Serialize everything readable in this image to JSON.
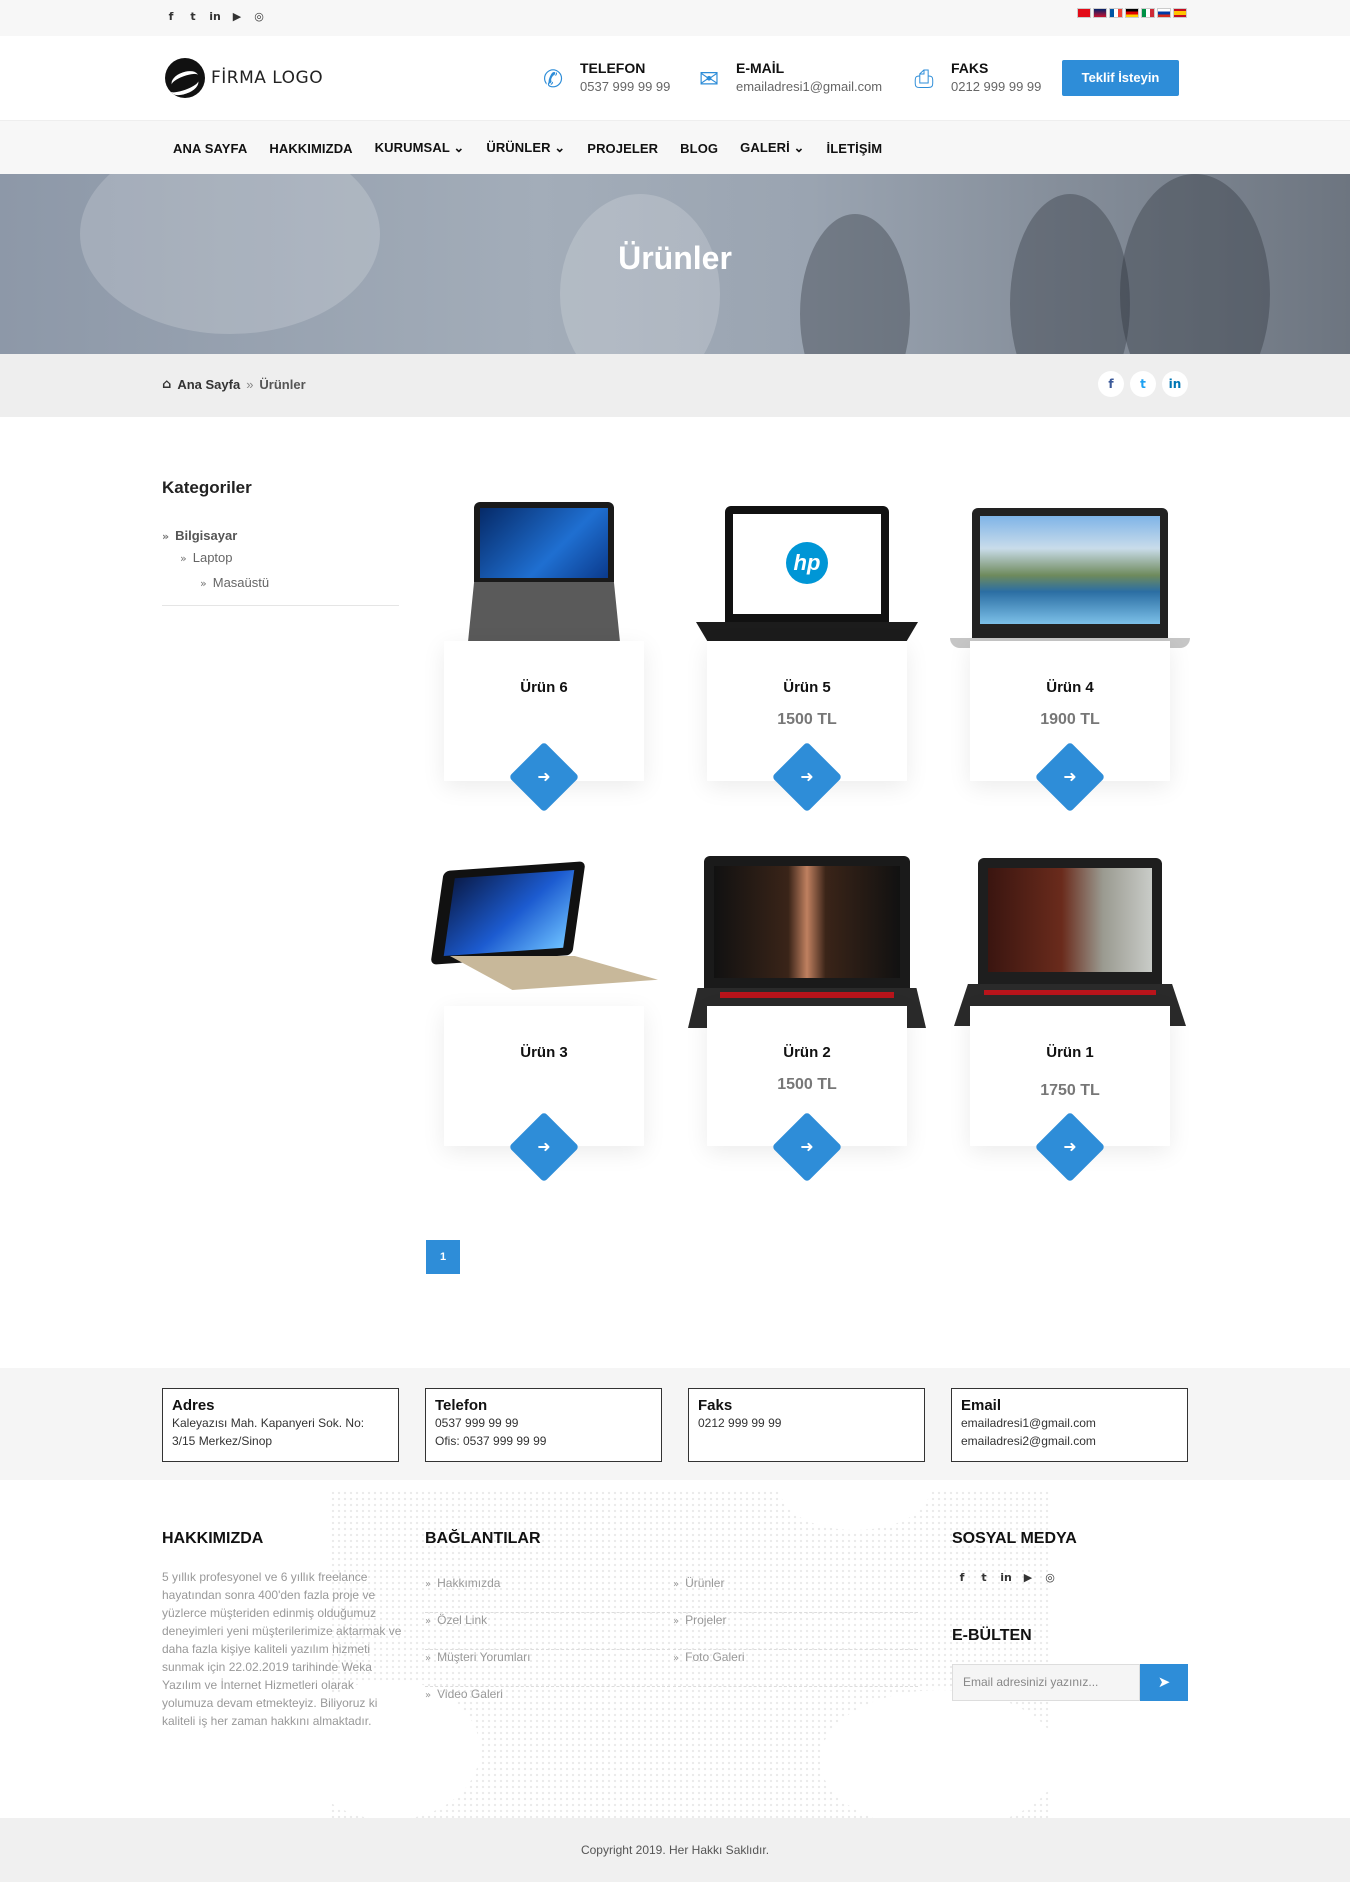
{
  "topbar": {
    "social": [
      "f",
      "t",
      "in",
      "yt",
      "ig"
    ],
    "flags": [
      {
        "name": "tr",
        "color": "#e30a17"
      },
      {
        "name": "gb",
        "color": "#012169"
      },
      {
        "name": "fr",
        "color": "#0055a4"
      },
      {
        "name": "de",
        "color": "#000000"
      },
      {
        "name": "it",
        "color": "#009246"
      },
      {
        "name": "ru",
        "color": "#0039a6"
      },
      {
        "name": "es",
        "color": "#c60b1e"
      }
    ]
  },
  "header": {
    "logo_text": "FİRMA LOGO",
    "phone": {
      "title": "TELEFON",
      "value": "0537 999 99 99"
    },
    "email": {
      "title": "E-MAİL",
      "value": "emailadresi1@gmail.com"
    },
    "fax": {
      "title": "FAKS",
      "value": "0212 999 99 99"
    },
    "cta": "Teklif İsteyin"
  },
  "nav": [
    "ANA SAYFA",
    "HAKKIMIZDA",
    "KURUMSAL ⌄",
    "ÜRÜNLER ⌄",
    "PROJELER",
    "BLOG",
    "GALERİ ⌄",
    "İLETİŞİM"
  ],
  "banner": {
    "title": "Ürünler"
  },
  "breadcrumb": {
    "home": "Ana Sayfa",
    "sep": "»",
    "current": "Ürünler"
  },
  "share": [
    "f",
    "t",
    "in"
  ],
  "sidebar": {
    "title": "Kategoriler",
    "items": [
      "Bilgisayar",
      "Laptop",
      "Masaüstü"
    ]
  },
  "products": [
    {
      "name": "Ürün 6",
      "price": ""
    },
    {
      "name": "Ürün 5",
      "price": "1500 TL"
    },
    {
      "name": "Ürün 4",
      "price": "1900 TL"
    },
    {
      "name": "Ürün 3",
      "price": ""
    },
    {
      "name": "Ürün 2",
      "price": "1500 TL"
    },
    {
      "name": "Ürün 1",
      "price": "1750 TL"
    }
  ],
  "pagination": {
    "current": "1"
  },
  "info": {
    "address": {
      "title": "Adres",
      "lines": [
        "Kaleyazısı Mah. Kapanyeri Sok. No:",
        "3/15 Merkez/Sinop"
      ]
    },
    "phone": {
      "title": "Telefon",
      "lines": [
        "0537 999 99 99",
        "Ofis: 0537 999 99 99"
      ]
    },
    "fax": {
      "title": "Faks",
      "lines": [
        "0212 999 99 99"
      ]
    },
    "email": {
      "title": "Email",
      "lines": [
        "emailadresi1@gmail.com",
        "emailadresi2@gmail.com"
      ]
    }
  },
  "footer": {
    "about_title": "HAKKIMIZDA",
    "about_text": "5 yıllık profesyonel ve 6 yıllık freelance hayatından sonra 400'den fazla proje ve yüzlerce müşteriden edinmiş olduğumuz deneyimleri yeni müşterilerimize aktarmak ve daha fazla kişiye kaliteli yazılım hizmeti sunmak için 22.02.2019 tarihinde Weka Yazılım ve İnternet Hizmetleri olarak yolumuza devam etmekteyiz. Biliyoruz ki kaliteli iş her zaman hakkını almaktadır.",
    "links_title": "BAĞLANTILAR",
    "links_left": [
      "Hakkımızda",
      "Özel Link",
      "Müşteri Yorumları",
      "Video Galeri"
    ],
    "links_right": [
      "Ürünler",
      "Projeler",
      "Foto Galeri"
    ],
    "social_title": "SOSYAL MEDYA",
    "social": [
      "f",
      "t",
      "in",
      "yt",
      "ig"
    ],
    "newsletter_title": "E-BÜLTEN",
    "newsletter_placeholder": "Email adresinizi yazınız..."
  },
  "copyright": "Copyright 2019. Her Hakkı Saklıdır.",
  "colors": {
    "accent": "#2e8dd8"
  }
}
